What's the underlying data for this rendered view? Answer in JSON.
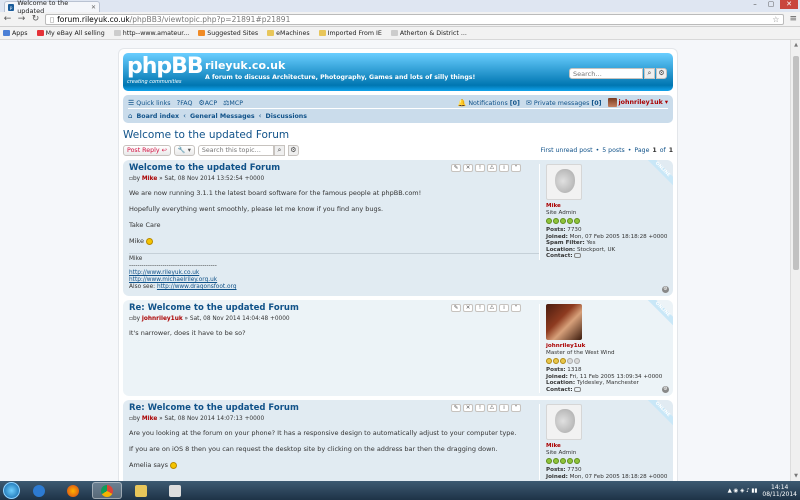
{
  "browser": {
    "tab_title": "Welcome to the updated",
    "url_host": "forum.rileyuk.co.uk",
    "url_path": "/phpBB3/viewtopic.php?p=21891#p21891",
    "bookmarks": [
      "Apps",
      "My eBay All selling",
      "http--www.amateur...",
      "Suggested Sites",
      "eMachines",
      "Imported From IE",
      "Atherton & District ..."
    ]
  },
  "header": {
    "logo_text": "phpBB",
    "logo_sub": "creating communities",
    "site_title": "rileyuk.co.uk",
    "site_desc": "A forum to discuss Architecture, Photography, Games and lots of silly things!",
    "search_placeholder": "Search…"
  },
  "navbar": {
    "quick_links": "Quick links",
    "faq": "FAQ",
    "acp": "ACP",
    "mcp": "MCP",
    "notifications": "Notifications",
    "notifications_count": "[0]",
    "private_messages": "Private messages",
    "pm_count": "[0]",
    "username": "johnriley1uk",
    "breadcrumbs": [
      "Board index",
      "General Messages",
      "Discussions"
    ]
  },
  "topic": {
    "title": "Welcome to the updated Forum",
    "post_reply": "Post Reply",
    "search_placeholder": "Search this topic…",
    "first_unread": "First unread post",
    "posts_count": "5 posts",
    "page_label": "Page",
    "page_cur": "1",
    "page_of": "of",
    "page_total": "1"
  },
  "posts": [
    {
      "title": "Welcome to the updated Forum",
      "by": "by",
      "author": "Mike",
      "date": "» Sat, 08 Nov 2014 13:52:54 +0000",
      "paragraphs": [
        "We are now running 3.1.1 the latest board software for the famous people at phpBB.com!",
        "Hopefully everything went smoothly, please let me know if you find any bugs.",
        "Take Care",
        "Mike"
      ],
      "signature_name": "Mike",
      "signature_line": "------------------------------------------",
      "sig_links": [
        "http://www.rileyuk.co.uk",
        "http://www.michaelriley.org.uk"
      ],
      "also_see": "Also see:",
      "also_see_link": "http://www.dragonsfoot.org",
      "profile": {
        "name": "Mike",
        "rank": "Site Admin",
        "posts_label": "Posts:",
        "posts": "7730",
        "joined_label": "Joined:",
        "joined": "Mon, 07 Feb 2005 18:18:28 +0000",
        "spam_label": "Spam Filter:",
        "spam": "Yes",
        "location_label": "Location:",
        "location": "Stockport, UK",
        "contact_label": "Contact:"
      },
      "online": "ONLINE"
    },
    {
      "title": "Re: Welcome to the updated Forum",
      "by": "by",
      "author": "johnriley1uk",
      "date": "» Sat, 08 Nov 2014 14:04:48 +0000",
      "paragraphs": [
        "It's narrower, does it have to be so?"
      ],
      "profile": {
        "name": "johnriley1uk",
        "rank": "Master of the West Wind",
        "posts_label": "Posts:",
        "posts": "1318",
        "joined_label": "Joined:",
        "joined": "Fri, 11 Feb 2005 13:09:34 +0000",
        "location_label": "Location:",
        "location": "Tyldesley, Manchester",
        "contact_label": "Contact:"
      },
      "online": "ONLINE"
    },
    {
      "title": "Re: Welcome to the updated Forum",
      "by": "by",
      "author": "Mike",
      "date": "» Sat, 08 Nov 2014 14:07:13 +0000",
      "paragraphs": [
        "Are you looking at the forum on your phone? It has a responsive design to automatically adjust to your computer type.",
        "If you are on iOS 8 then you can request the desktop site by clicking on the address bar then the dragging down.",
        "Amelia says"
      ],
      "profile": {
        "name": "Mike",
        "rank": "Site Admin",
        "posts_label": "Posts:",
        "posts": "7730",
        "joined_label": "Joined:",
        "joined": "Mon, 07 Feb 2005 18:18:28 +0000"
      },
      "online": "ONLINE"
    }
  ],
  "taskbar": {
    "time": "14:14",
    "date": "08/11/2014"
  }
}
